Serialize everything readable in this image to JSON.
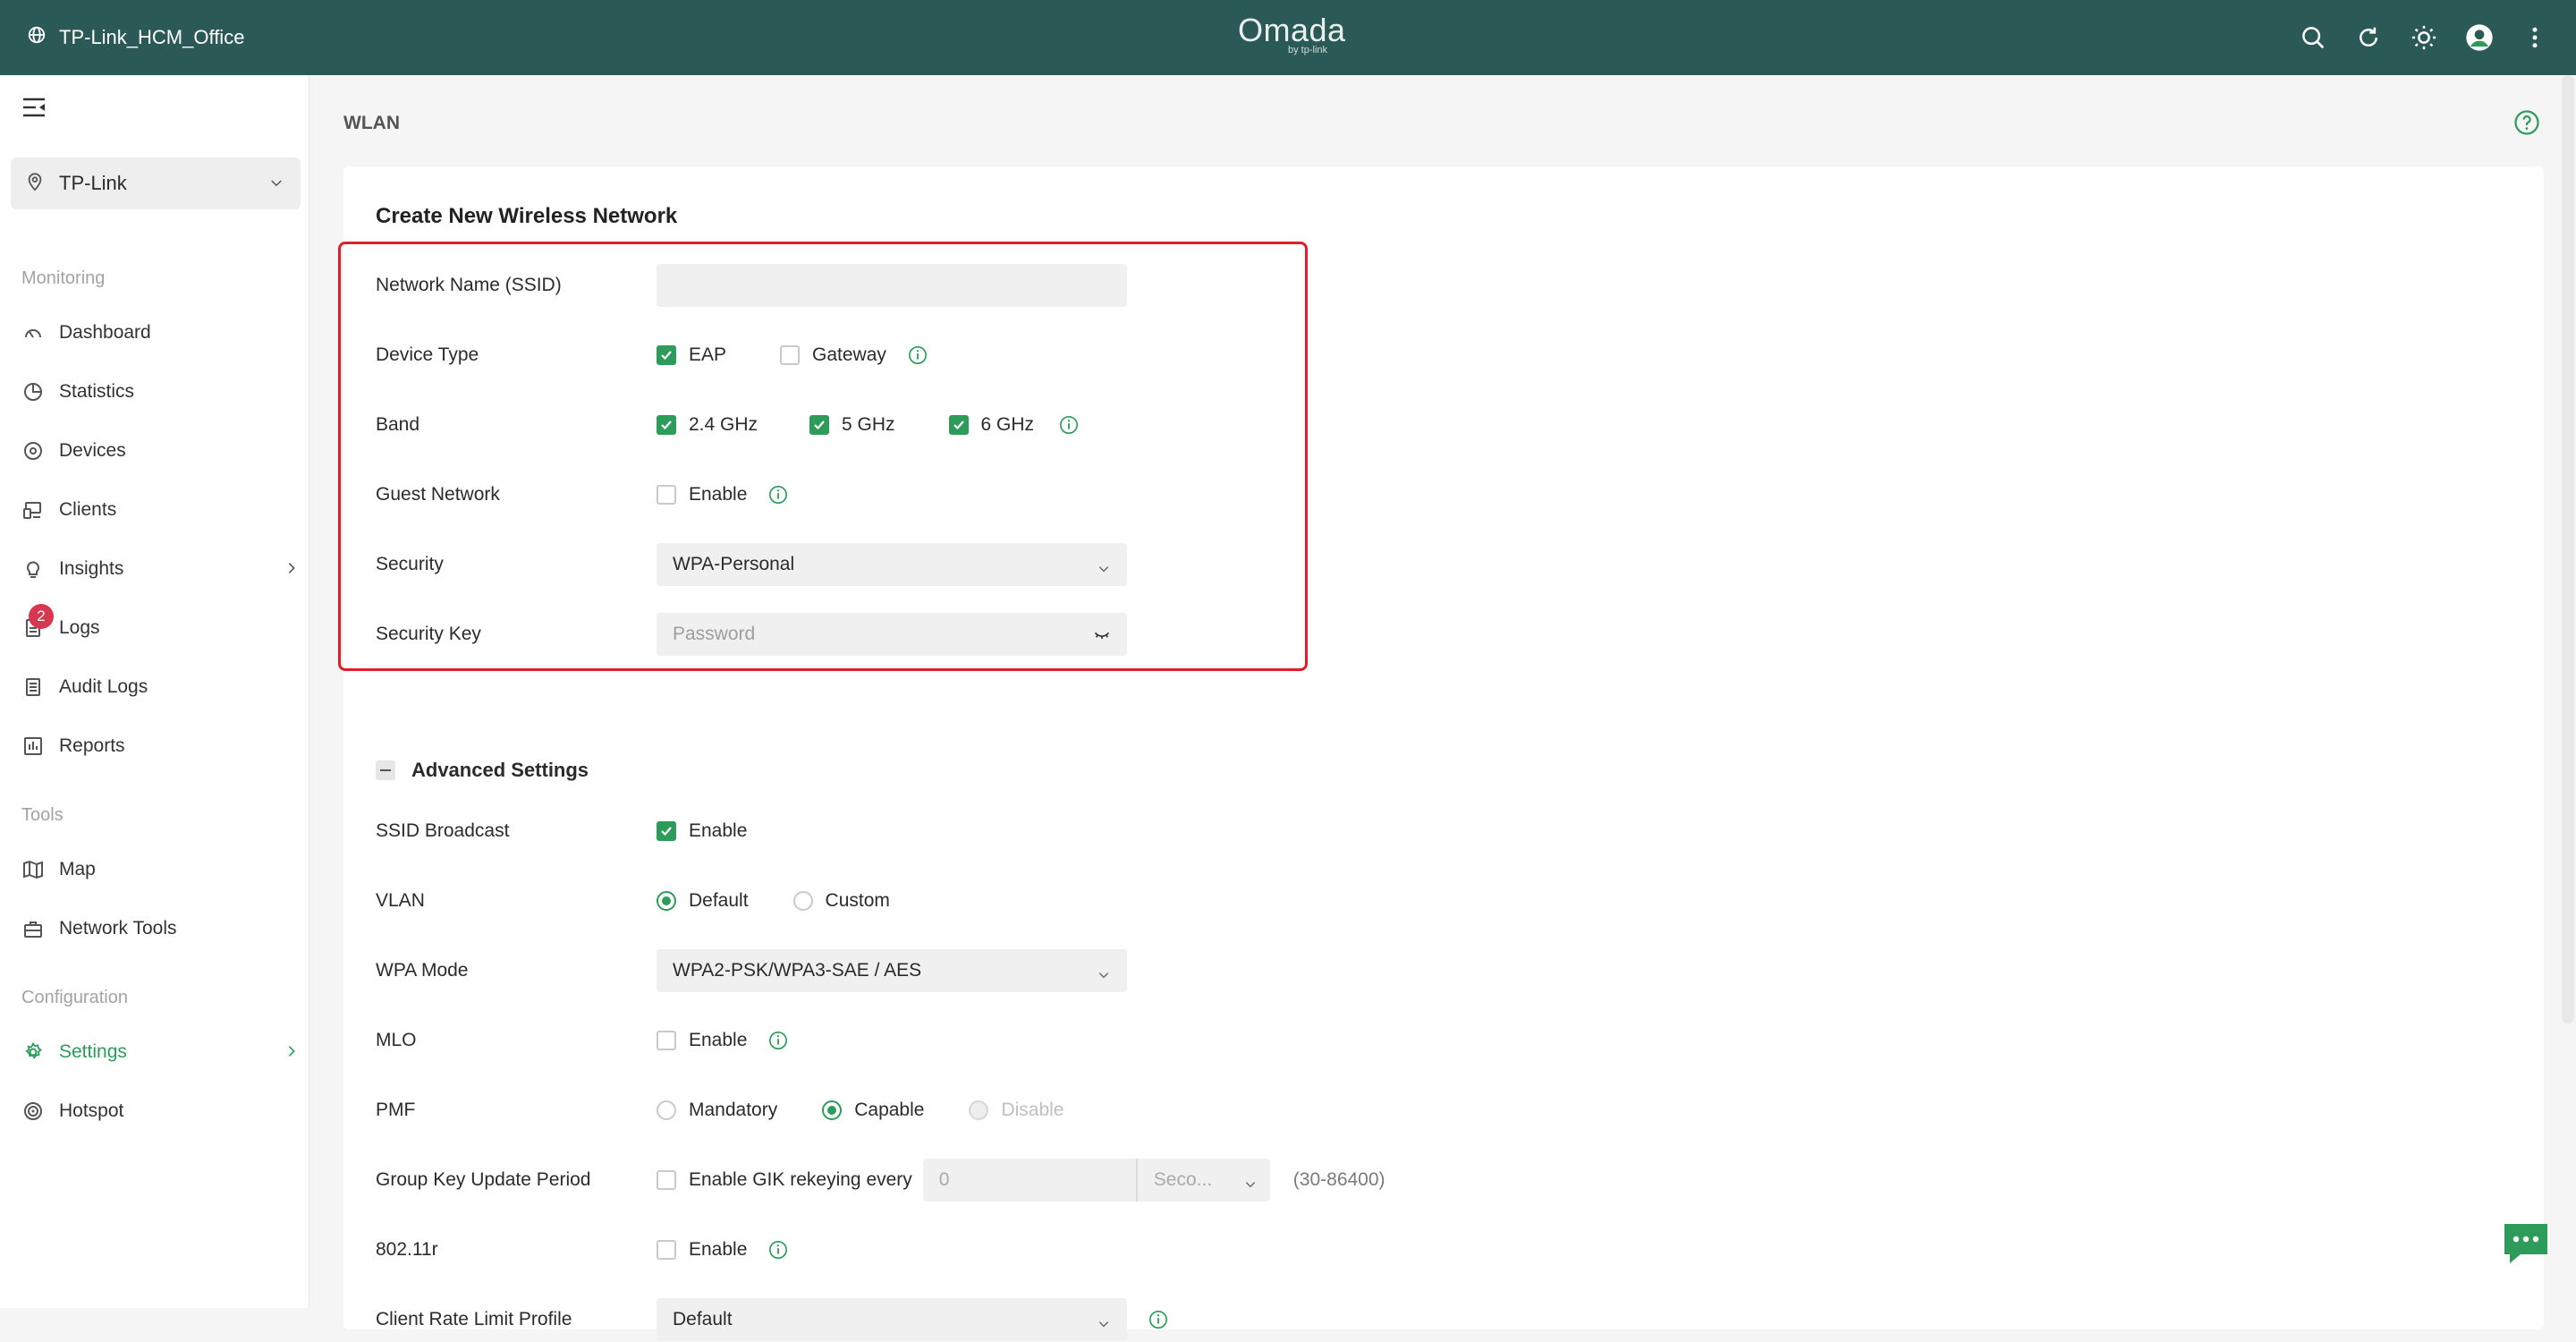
{
  "topbar": {
    "site_name": "TP-Link_HCM_Office",
    "logo_main": "Omada",
    "logo_sub": "by tp-link"
  },
  "sidebar": {
    "site_select": "TP-Link",
    "sections": {
      "monitoring": "Monitoring",
      "tools": "Tools",
      "configuration": "Configuration"
    },
    "items": [
      {
        "label": "Dashboard"
      },
      {
        "label": "Statistics"
      },
      {
        "label": "Devices"
      },
      {
        "label": "Clients"
      },
      {
        "label": "Insights"
      },
      {
        "label": "Logs",
        "badge": "2"
      },
      {
        "label": "Audit Logs"
      },
      {
        "label": "Reports"
      },
      {
        "label": "Map"
      },
      {
        "label": "Network Tools"
      },
      {
        "label": "Settings"
      },
      {
        "label": "Hotspot"
      }
    ]
  },
  "page": {
    "title": "WLAN",
    "card_title": "Create New Wireless Network"
  },
  "form": {
    "ssid": {
      "label": "Network Name (SSID)",
      "value": ""
    },
    "device_type": {
      "label": "Device Type",
      "options": [
        {
          "label": "EAP",
          "checked": true
        },
        {
          "label": "Gateway",
          "checked": false
        }
      ]
    },
    "band": {
      "label": "Band",
      "options": [
        {
          "label": "2.4 GHz",
          "checked": true
        },
        {
          "label": "5 GHz",
          "checked": true
        },
        {
          "label": "6 GHz",
          "checked": true
        }
      ]
    },
    "guest": {
      "label": "Guest Network",
      "option": "Enable",
      "checked": false
    },
    "security": {
      "label": "Security",
      "value": "WPA-Personal"
    },
    "security_key": {
      "label": "Security Key",
      "placeholder": "Password"
    }
  },
  "advanced": {
    "title": "Advanced Settings",
    "ssid_broadcast": {
      "label": "SSID Broadcast",
      "option": "Enable",
      "checked": true
    },
    "vlan": {
      "label": "VLAN",
      "options": [
        "Default",
        "Custom"
      ],
      "selected": "Default"
    },
    "wpa_mode": {
      "label": "WPA Mode",
      "value": "WPA2-PSK/WPA3-SAE / AES"
    },
    "mlo": {
      "label": "MLO",
      "option": "Enable",
      "checked": false
    },
    "pmf": {
      "label": "PMF",
      "options": [
        "Mandatory",
        "Capable",
        "Disable"
      ],
      "selected": "Capable"
    },
    "gik": {
      "label": "Group Key Update Period",
      "option": "Enable GIK rekeying every",
      "value": "0",
      "unit": "Seco...",
      "range": "(30-86400)"
    },
    "r80211": {
      "label": "802.11r",
      "option": "Enable",
      "checked": false
    },
    "client_rate": {
      "label": "Client Rate Limit Profile",
      "value": "Default"
    }
  },
  "colors": {
    "topbar": "#2b5a56",
    "accent": "#2d9c5a",
    "highlight_border": "#e01e2a",
    "badge": "#d6384f"
  }
}
